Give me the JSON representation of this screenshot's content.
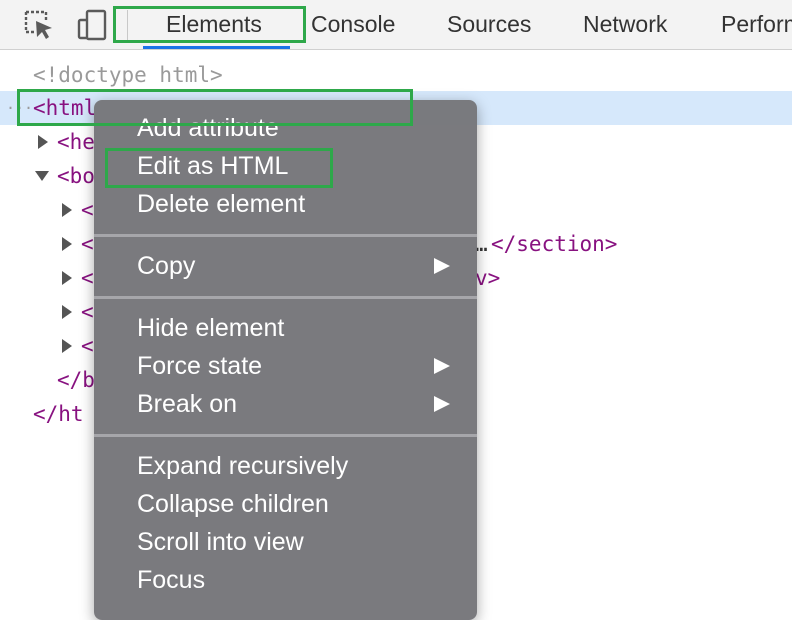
{
  "toolbar": {
    "icons": [
      "inspect-element-icon",
      "device-toolbar-icon"
    ],
    "tabs": [
      {
        "label": "Elements",
        "active": true
      },
      {
        "label": "Console"
      },
      {
        "label": "Sources"
      },
      {
        "label": "Network"
      },
      {
        "label": "Perform"
      }
    ]
  },
  "tree": {
    "doctype": "<!doctype html>",
    "html_open": "<html",
    "html_ellipsis": "···",
    "head_open": "<he",
    "body_open": "<bo",
    "child_open": "<",
    "child_2_trail_ellipsis": "…",
    "child_2_trail_tag": "</section>",
    "child_3_trail": "v>",
    "body_close": "</b",
    "html_close": "</ht"
  },
  "context_menu": {
    "items": [
      {
        "label": "Add attribute"
      },
      {
        "label": "Edit as HTML",
        "highlighted": true
      },
      {
        "label": "Delete element"
      },
      {
        "label": "Copy",
        "submenu": true
      },
      {
        "label": "Hide element"
      },
      {
        "label": "Force state",
        "submenu": true
      },
      {
        "label": "Break on",
        "submenu": true
      },
      {
        "label": "Expand recursively"
      },
      {
        "label": "Collapse children"
      },
      {
        "label": "Scroll into view"
      },
      {
        "label": "Focus"
      }
    ]
  },
  "colors": {
    "highlight_box": "#2ea84a",
    "active_tab_underline": "#1a73e8",
    "selected_row": "#d6e8fb",
    "menu_background": "#76767a",
    "tag_purple": "#881280"
  }
}
